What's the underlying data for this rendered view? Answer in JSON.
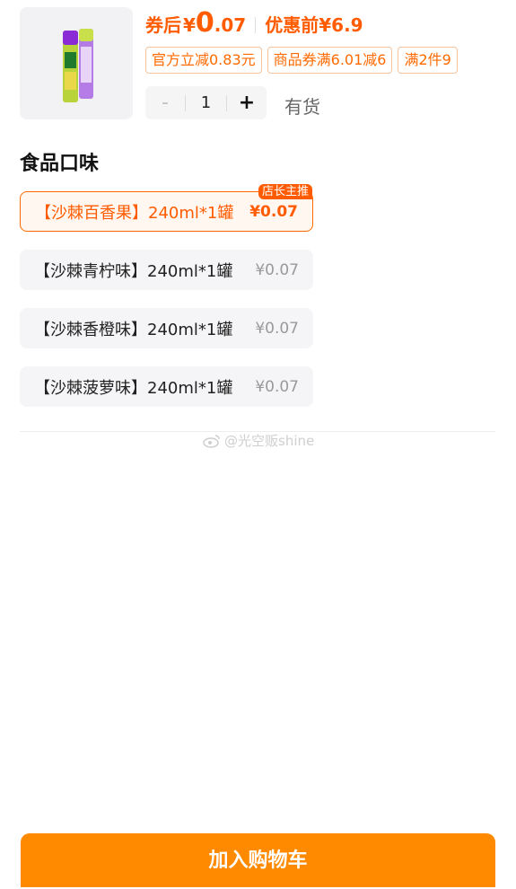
{
  "product": {
    "image_icon": "drink-can-image",
    "price_label": "券后",
    "currency": "¥",
    "price_int": "0",
    "price_dec": ".07",
    "orig_label": "优惠前",
    "orig_price": "¥6.9"
  },
  "coupons": [
    "官方立减0.83元",
    "商品券满6.01减6",
    "满2件9"
  ],
  "quantity": {
    "minus": "-",
    "value": "1",
    "plus": "+",
    "stock": "有货"
  },
  "section": {
    "title": "食品口味"
  },
  "options": [
    {
      "name": "【沙棘百香果】240ml*1罐",
      "price": "¥0.07",
      "badge": "店长主推",
      "selected": true
    },
    {
      "name": "【沙棘青柠味】240ml*1罐",
      "price": "¥0.07"
    },
    {
      "name": "【沙棘香橙味】240ml*1罐",
      "price": "¥0.07"
    },
    {
      "name": "【沙棘菠萝味】240ml*1罐",
      "price": "¥0.07"
    }
  ],
  "watermark": {
    "text": "@光空贩shine"
  },
  "cta": {
    "label": "加入购物车"
  },
  "colors": {
    "accent": "#ff5b00",
    "cta": "#ff8a00"
  }
}
